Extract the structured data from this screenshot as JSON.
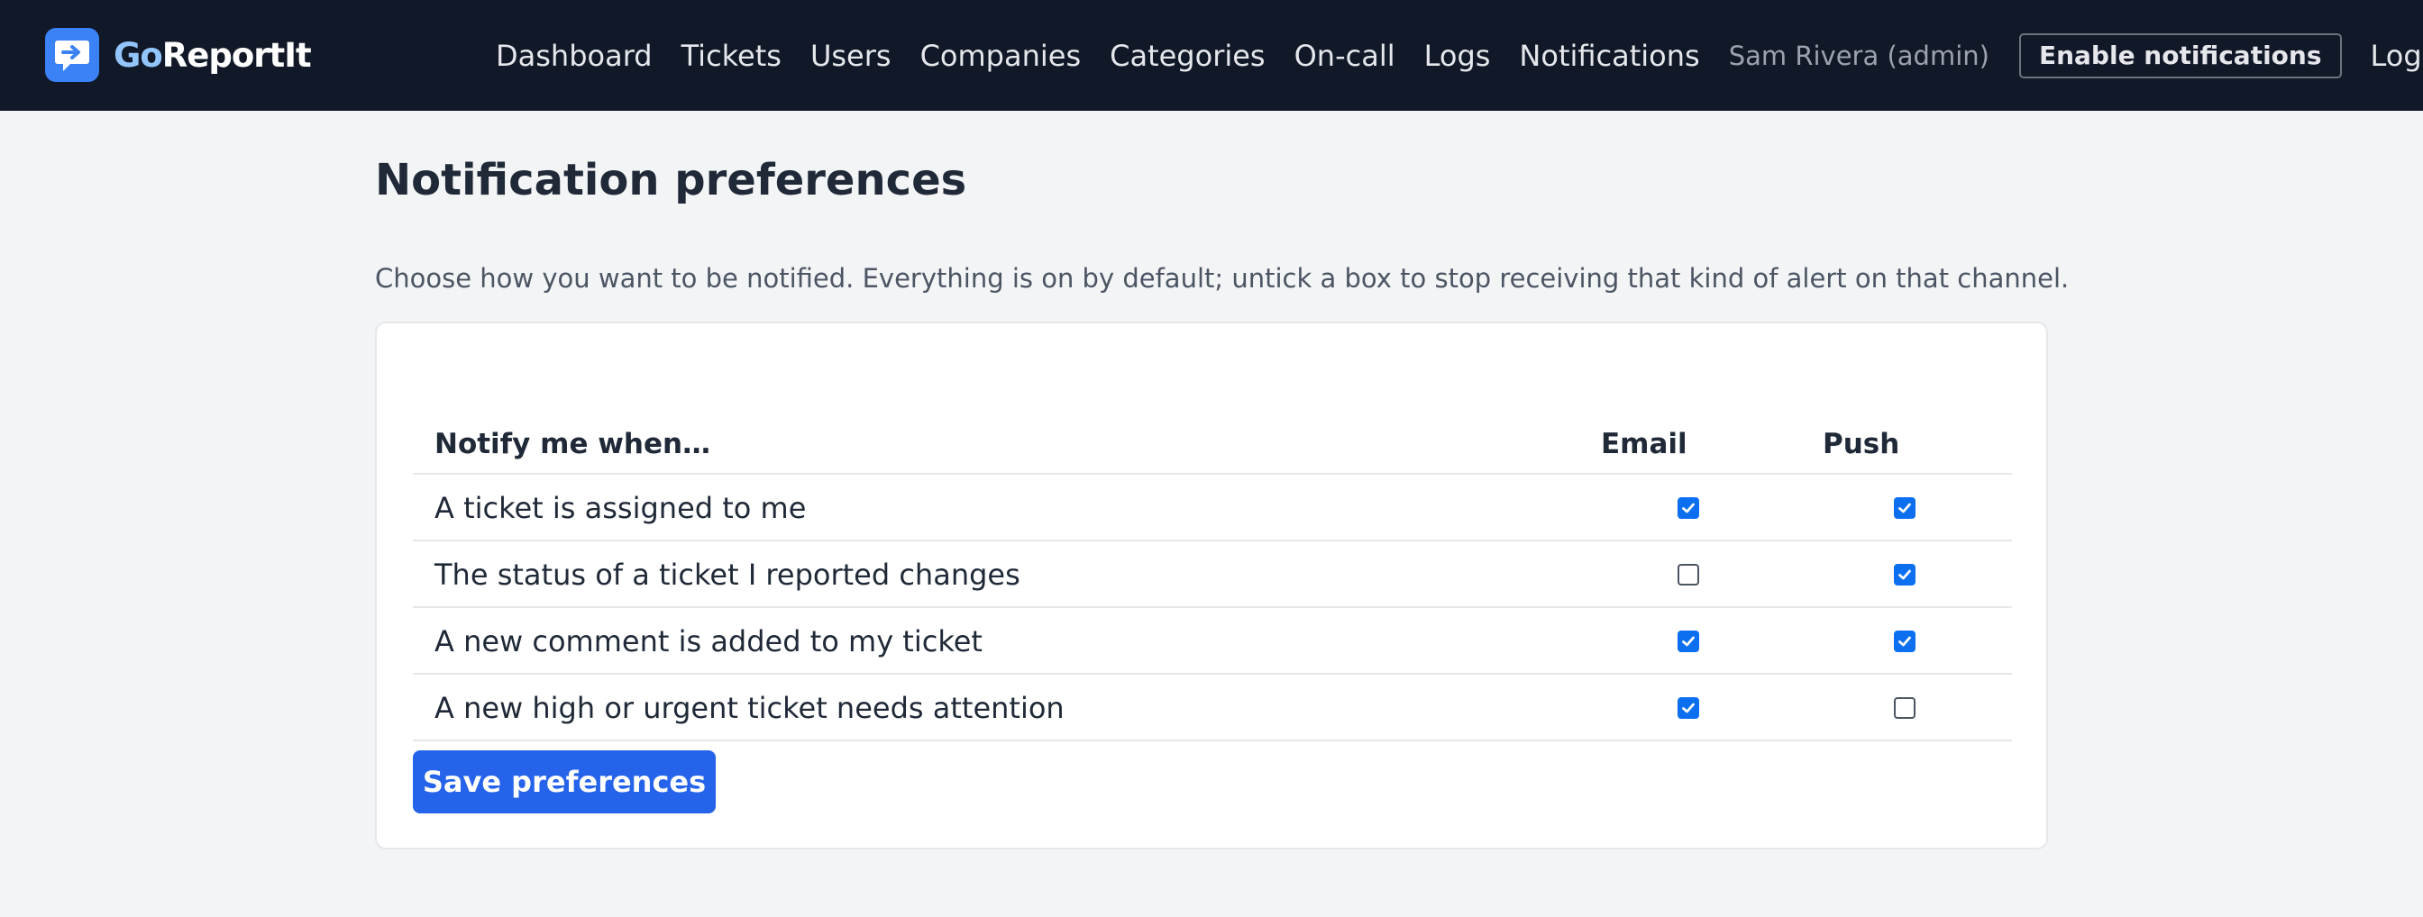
{
  "header": {
    "brand": {
      "prefix": "Go",
      "suffix": "ReportIt",
      "logo_icon": "chat-bubble-arrow-icon",
      "accent": "#3b82f6"
    },
    "nav": [
      "Dashboard",
      "Tickets",
      "Users",
      "Companies",
      "Categories",
      "On-call",
      "Logs",
      "Notifications"
    ],
    "user": "Sam Rivera (admin)",
    "enable_notifications": "Enable notifications",
    "logout": "Log out",
    "background": "#111827"
  },
  "page": {
    "title": "Notification preferences",
    "intro": "Choose how you want to be notified. Everything is on by default; untick a box to stop receiving that kind of alert on that channel."
  },
  "prefs": {
    "columns": {
      "event": "Notify me when…",
      "email": "Email",
      "push": "Push"
    },
    "rows": [
      {
        "label": "A ticket is assigned to me",
        "email": true,
        "push": true
      },
      {
        "label": "The status of a ticket I reported changes",
        "email": false,
        "push": true
      },
      {
        "label": "A new comment is added to my ticket",
        "email": true,
        "push": true
      },
      {
        "label": "A new high or urgent ticket needs attention",
        "email": true,
        "push": false
      }
    ],
    "checked_color": "#0b6ff0"
  },
  "save_button": "Save preferences",
  "save_color": "#2563eb"
}
